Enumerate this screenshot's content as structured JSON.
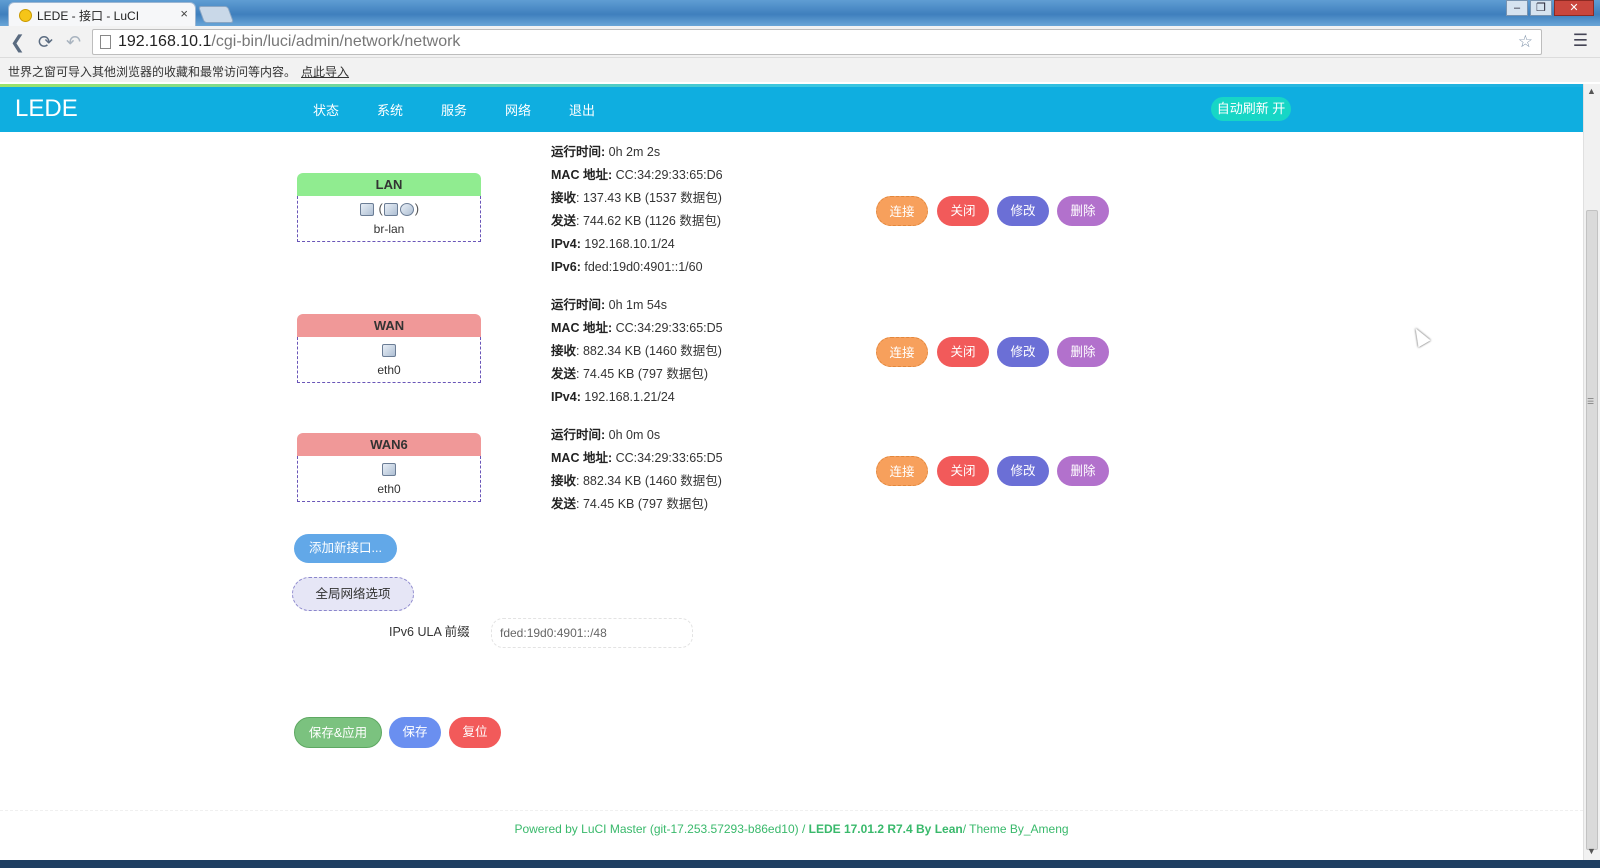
{
  "browser": {
    "tab_title": "LEDE - 接口 - LuCI",
    "tab_close": "×",
    "url_host": "192.168.10.1",
    "url_path": "/cgi-bin/luci/admin/network/network",
    "bookmark_text": "世界之窗可导入其他浏览器的收藏和最常访问等内容。",
    "bookmark_link": "点此导入",
    "icons": [
      "back-icon",
      "reload-icon",
      "undo-icon",
      "page-icon",
      "star-icon",
      "menu-icon"
    ]
  },
  "header": {
    "brand": "LEDE",
    "nav": [
      "状态",
      "系统",
      "服务",
      "网络",
      "退出"
    ],
    "auto_refresh": "自动刷新 开",
    "bg_color": "#0faee0"
  },
  "interfaces": [
    {
      "name": "LAN",
      "device": "br-lan",
      "head_color": "#90ec90",
      "stats": [
        {
          "label": "运行时间",
          "value": "0h 2m 2s"
        },
        {
          "label": "MAC 地址",
          "value": "CC:34:29:33:65:D6"
        },
        {
          "label": "接收",
          "value": "137.43 KB (1537 数据包)"
        },
        {
          "label": "发送",
          "value": "744.62 KB (1126 数据包)"
        },
        {
          "label": "IPv4",
          "value": "192.168.10.1/24"
        },
        {
          "label": "IPv6",
          "value": "fded:19d0:4901::1/60"
        }
      ]
    },
    {
      "name": "WAN",
      "device": "eth0",
      "head_color": "#f09898",
      "stats": [
        {
          "label": "运行时间",
          "value": "0h 1m 54s"
        },
        {
          "label": "MAC 地址",
          "value": "CC:34:29:33:65:D5"
        },
        {
          "label": "接收",
          "value": "882.34 KB (1460 数据包)"
        },
        {
          "label": "发送",
          "value": "74.45 KB (797 数据包)"
        },
        {
          "label": "IPv4",
          "value": "192.168.1.21/24"
        }
      ]
    },
    {
      "name": "WAN6",
      "device": "eth0",
      "head_color": "#f09898",
      "stats": [
        {
          "label": "运行时间",
          "value": "0h 0m 0s"
        },
        {
          "label": "MAC 地址",
          "value": "CC:34:29:33:65:D5"
        },
        {
          "label": "接收",
          "value": "882.34 KB (1460 数据包)"
        },
        {
          "label": "发送",
          "value": "74.45 KB (797 数据包)"
        }
      ]
    }
  ],
  "actions": {
    "connect": "连接",
    "close": "关闭",
    "edit": "修改",
    "delete": "删除"
  },
  "add_interface": "添加新接口...",
  "global_options": "全局网络选项",
  "ula": {
    "label": "IPv6 ULA 前缀",
    "value": "fded:19d0:4901::/48"
  },
  "footer_buttons": {
    "save_apply": "保存&应用",
    "save": "保存",
    "reset": "复位"
  },
  "footer": {
    "powered": "Powered by LuCI Master (git-17.253.57293-b86ed10) / ",
    "lede": "LEDE 17.01.2 R7.4 By Lean",
    "theme": "/ Theme By_Ameng"
  }
}
